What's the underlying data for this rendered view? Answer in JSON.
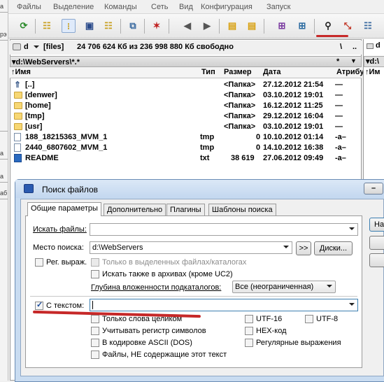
{
  "menu": [
    "Файлы",
    "Выделение",
    "Команды",
    "Сеть",
    "Вид",
    "Конфигурация",
    "Запуск"
  ],
  "left_strip_tabs": [
    "а",
    "рэ",
    "",
    "а",
    "а",
    "аб"
  ],
  "drive": {
    "letter": "d",
    "label": "[files]",
    "free_text": "24 706 624 Кб из 236 998 880 Кб свободно",
    "root_btn": "\\",
    "up_btn": "..",
    "right_drive": "d"
  },
  "path": {
    "text": "▾d:\\WebServers\\*.*",
    "star": "*",
    "arrow": "▼",
    "right": "▾d:\\"
  },
  "columns": {
    "name": "↑Имя",
    "ext": "Тип",
    "size": "Размер",
    "date": "Дата",
    "attr": "Атрибу",
    "right": "↑Им"
  },
  "files": [
    {
      "name": "[..]",
      "ext": "",
      "size": "<Папка>",
      "date": "27.12.2012 21:54",
      "attr": "—",
      "kind": "up"
    },
    {
      "name": "[denwer]",
      "ext": "",
      "size": "<Папка>",
      "date": "03.10.2012 19:01",
      "attr": "—",
      "kind": "folder"
    },
    {
      "name": "[home]",
      "ext": "",
      "size": "<Папка>",
      "date": "16.12.2012 11:25",
      "attr": "—",
      "kind": "folder"
    },
    {
      "name": "[tmp]",
      "ext": "",
      "size": "<Папка>",
      "date": "29.12.2012 16:04",
      "attr": "—",
      "kind": "folder"
    },
    {
      "name": "[usr]",
      "ext": "",
      "size": "<Папка>",
      "date": "03.10.2012 19:01",
      "attr": "—",
      "kind": "folder"
    },
    {
      "name": "188_18215363_MVM_1",
      "ext": "tmp",
      "size": "0",
      "date": "10.10.2012 01:14",
      "attr": "-a–",
      "kind": "file"
    },
    {
      "name": "2440_6807602_MVM_1",
      "ext": "tmp",
      "size": "0",
      "date": "14.10.2012 16:38",
      "attr": "-a–",
      "kind": "file"
    },
    {
      "name": "README",
      "ext": "txt",
      "size": "38 619",
      "date": "27.06.2012 09:49",
      "attr": "-a–",
      "kind": "readme"
    }
  ],
  "dialog": {
    "title": "Поиск файлов",
    "tabs": [
      "Общие параметры",
      "Дополнительно",
      "Плагины",
      "Шаблоны поиска"
    ],
    "search_files_label": "Искать файлы:",
    "search_files_value": "",
    "search_place_label": "Место поиска:",
    "search_place_value": "d:\\WebServers",
    "browse_arrows": ">>",
    "drives_btn": "Диски...",
    "regex_label": "Рег. выраж.",
    "only_selected": "Только в выделенных файлах/каталогах",
    "search_archives": "Искать также в архивах (кроме UC2)",
    "depth_label": "Глубина вложенности подкаталогов:",
    "depth_value": "Все (неограниченная)",
    "with_text_label": "С текстом:",
    "with_text_value": "",
    "whole_words": "Только слова целиком",
    "case_sensitive": "Учитывать регистр символов",
    "ascii": "В кодировке ASCII (DOS)",
    "not_containing": "Файлы, НЕ содержащие этот текст",
    "utf16": "UTF-16",
    "utf8": "UTF-8",
    "hex": "HEX-код",
    "regex_text": "Регулярные выражения",
    "side_btn": "На"
  }
}
